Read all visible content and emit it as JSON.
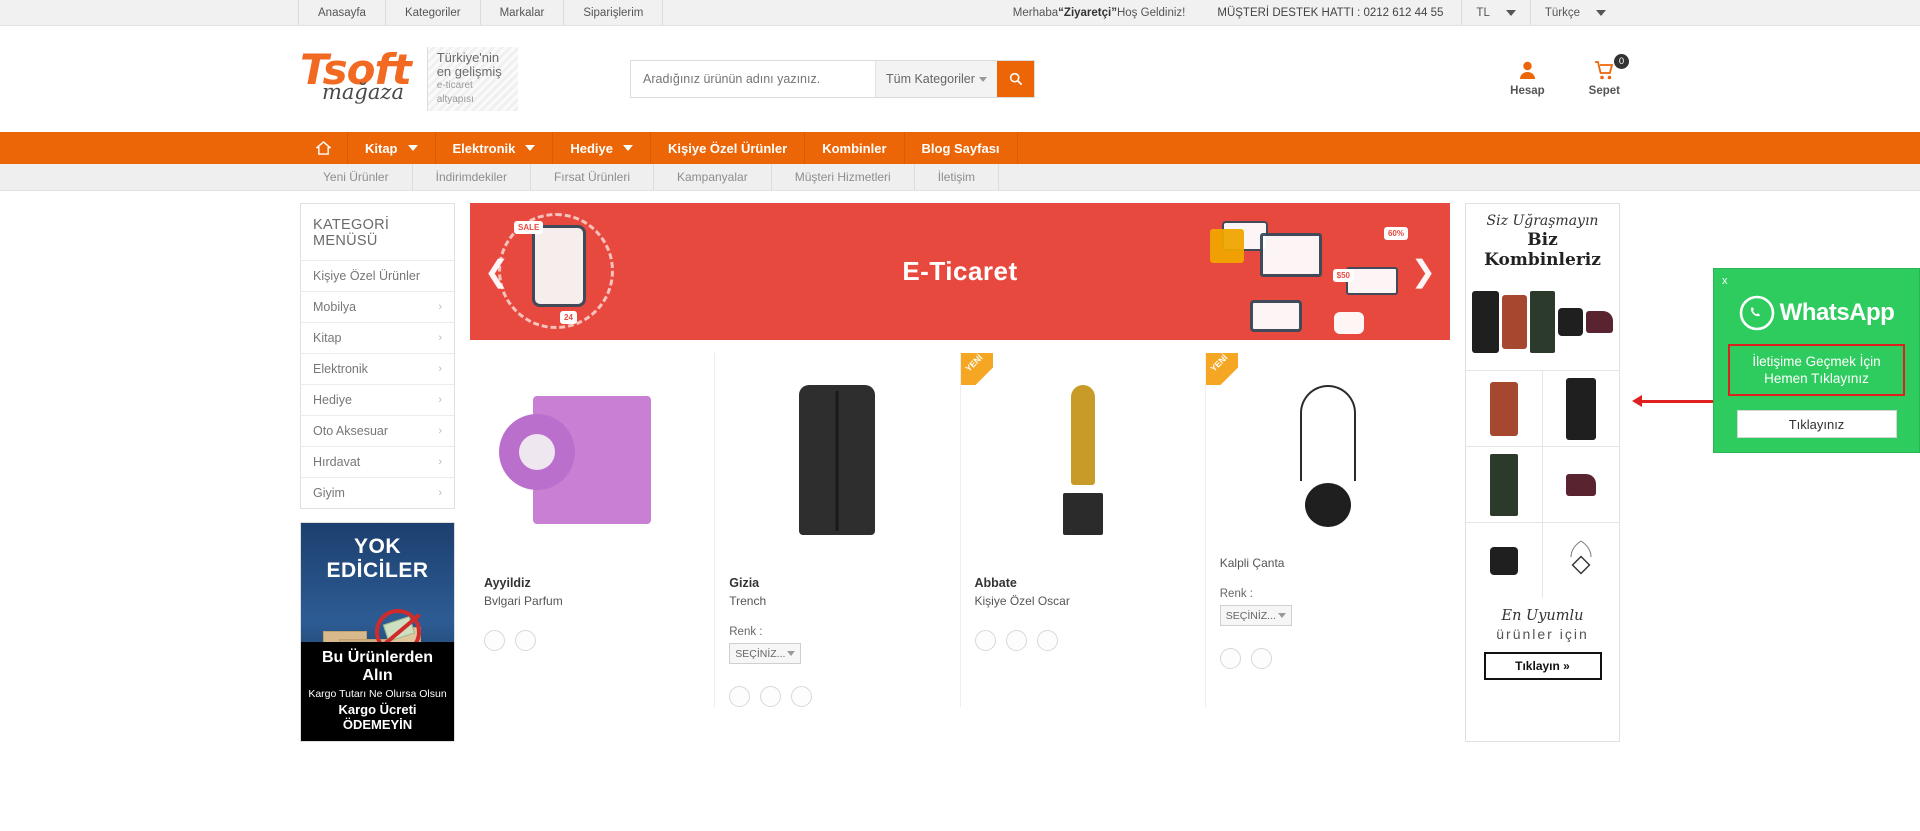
{
  "topbar": {
    "links": [
      {
        "label": "Anasayfa"
      },
      {
        "label": "Kategoriler"
      },
      {
        "label": "Markalar"
      },
      {
        "label": "Siparişlerim"
      }
    ],
    "welcome_prefix": "Merhaba ",
    "welcome_user": "“Ziyaretçi”",
    "welcome_suffix": " Hoş Geldiniz!",
    "support": "MÜŞTERİ DESTEK HATTI : 0212 612 44 55",
    "currency": "TL",
    "language": "Türkçe"
  },
  "header": {
    "logo_main": "Tsoft",
    "logo_sub": "mağaza",
    "tagline_l1": "Türkiye'nin",
    "tagline_l2": "en gelişmiş",
    "tagline_l3": "e-ticaret altyapısı",
    "search_placeholder": "Aradığınız ürünün adını yazınız.",
    "search_value": "",
    "search_category": "Tüm Kategoriler",
    "search_icon": "search-icon",
    "account_label": "Hesap",
    "account_icon": "user-icon",
    "cart_label": "Sepet",
    "cart_icon": "cart-icon",
    "cart_count": "0"
  },
  "mainnav": {
    "home_icon": "home-icon",
    "items": [
      {
        "label": "Kitap",
        "caret": true
      },
      {
        "label": "Elektronik",
        "caret": true
      },
      {
        "label": "Hediye",
        "caret": true
      },
      {
        "label": "Kişiye Özel Ürünler",
        "caret": false
      },
      {
        "label": "Kombinler",
        "caret": false
      },
      {
        "label": "Blog Sayfası",
        "caret": false
      }
    ]
  },
  "subnav": {
    "items": [
      {
        "label": "Yeni Ürünler"
      },
      {
        "label": "İndirimdekiler"
      },
      {
        "label": "Fırsat Ürünleri"
      },
      {
        "label": "Kampanyalar"
      },
      {
        "label": "Müşteri Hizmetleri"
      },
      {
        "label": "İletişim"
      }
    ]
  },
  "sidebar": {
    "title": "KATEGORİ MENÜSÜ",
    "items": [
      {
        "label": "Kişiye Özel Ürünler",
        "chevron": ""
      },
      {
        "label": "Mobilya",
        "chevron": "›"
      },
      {
        "label": "Kitap",
        "chevron": "›"
      },
      {
        "label": "Elektronik",
        "chevron": "›"
      },
      {
        "label": "Hediye",
        "chevron": "›"
      },
      {
        "label": "Oto Aksesuar",
        "chevron": "›"
      },
      {
        "label": "Hırdavat",
        "chevron": "›"
      },
      {
        "label": "Giyim",
        "chevron": "›"
      }
    ],
    "promo": {
      "title": "YOK EDİCİLER",
      "line1": "Bu Ürünlerden Alın",
      "line2": "Kargo Tutarı  Ne Olursa Olsun",
      "line3": "Kargo Ücreti ÖDEMEYİN"
    }
  },
  "slider": {
    "title": "E-Ticaret",
    "prev_icon": "chevron-left-icon",
    "next_icon": "chevron-right-icon",
    "chips": [
      "SALE",
      "60%",
      "$50",
      "24"
    ]
  },
  "products": [
    {
      "badge": "",
      "brand": "Ayyildiz",
      "name": "Bvlgari Parfum",
      "color_label": "",
      "color_value": "",
      "has_dots": true,
      "image": "perfume-image"
    },
    {
      "badge": "",
      "brand": "Gizia",
      "name": "Trench",
      "color_label": "Renk :",
      "color_value": "SEÇİNİZ...",
      "has_dots": true,
      "image": "coat-image"
    },
    {
      "badge": "YENİ",
      "brand": "Abbate",
      "name": "Kişiye Özel Oscar",
      "color_label": "",
      "color_value": "",
      "has_dots": true,
      "image": "oscar-image"
    },
    {
      "badge": "YENİ",
      "brand": "",
      "name": "Kalpli Çanta",
      "color_label": "Renk :",
      "color_value": "SEÇİNİZ...",
      "has_dots": true,
      "image": "bag-image"
    }
  ],
  "rightcol": {
    "head_l1": "Siz Uğraşmayın",
    "head_l2": "Biz Kombinleriz",
    "foot_l1": "En Uyumlu",
    "foot_l2": "ürünler için",
    "button": "Tıklayın »"
  },
  "whatsapp": {
    "close_label": "x",
    "brand": "WhatsApp",
    "brand_icon": "whatsapp-icon",
    "message_l1": "İletişime Geçmek İçin",
    "message_l2": "Hemen Tıklayınız",
    "button": "Tıklayınız",
    "accent_green": "#2ecc5e",
    "accent_red": "#e02020"
  },
  "colors": {
    "brand_orange": "#ec6608",
    "slider_red": "#e8493f"
  }
}
